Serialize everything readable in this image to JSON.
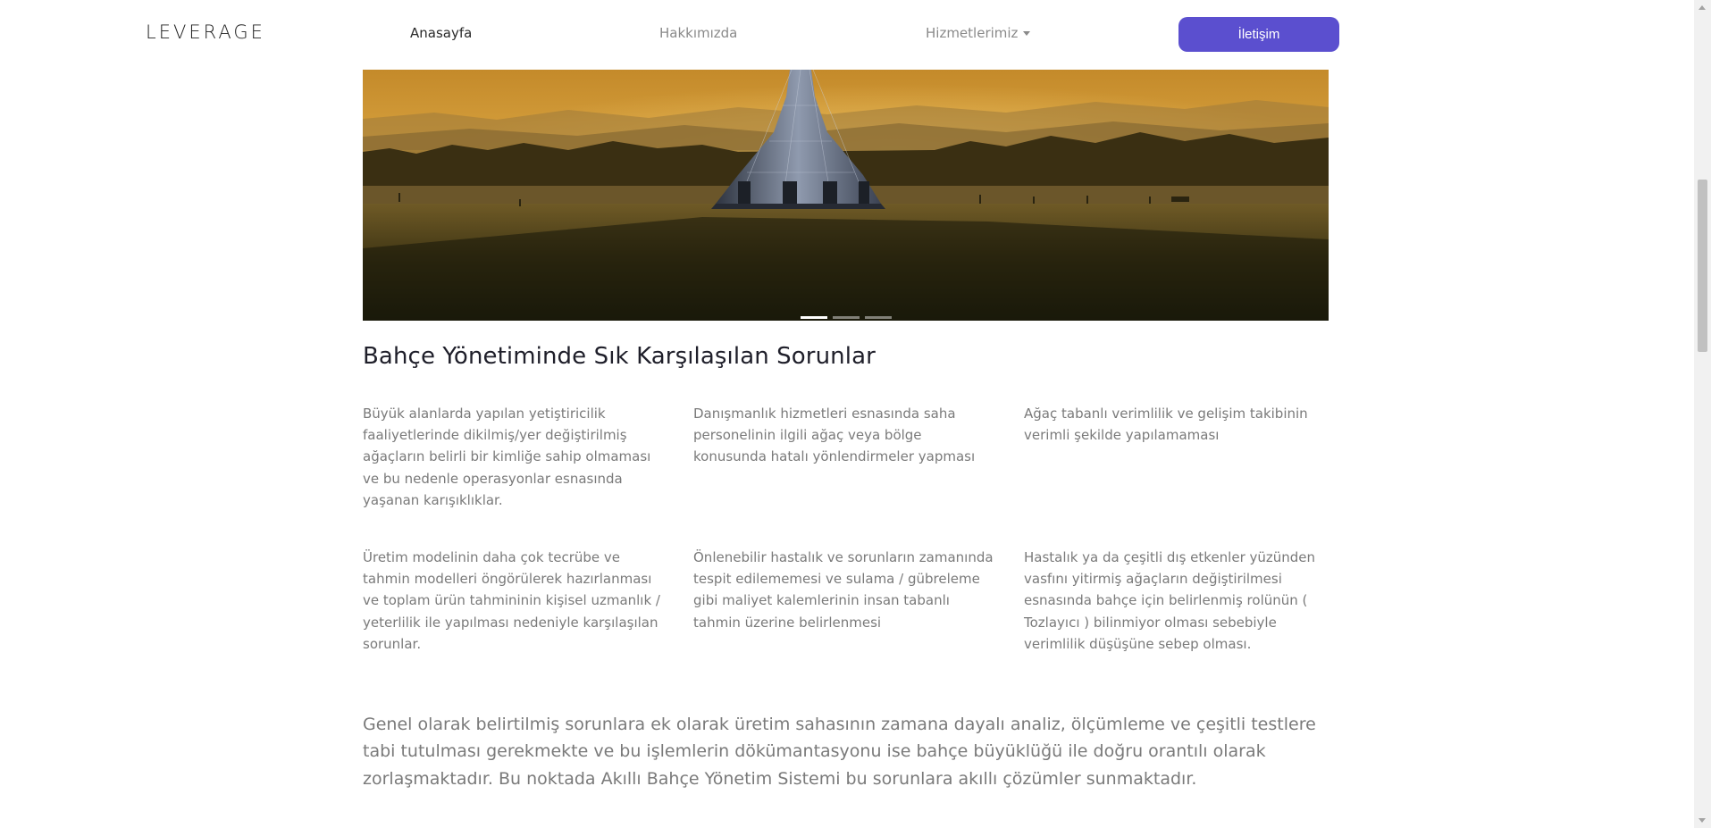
{
  "header": {
    "logo": "LEVERAGE",
    "nav": {
      "home": "Anasayfa",
      "about": "Hakkımızda",
      "services": "Hizmetlerimiz",
      "contact": "İletişim"
    }
  },
  "hero": {
    "slide_count": 3,
    "active_slide": 1
  },
  "section": {
    "title": "Bahçe Yönetiminde Sık Karşılaşılan Sorunlar",
    "problems": [
      "Büyük alanlarda yapılan yetiştiricilik faaliyetlerinde dikilmiş/yer değiştirilmiş ağaçların belirli bir kimliğe sahip olmaması ve bu nedenle operasyonlar esnasında yaşanan karışıklıklar.",
      "Danışmanlık hizmetleri esnasında saha personelinin ilgili ağaç veya bölge konusunda hatalı yönlendirmeler yapması",
      "Ağaç tabanlı verimlilik ve gelişim takibinin verimli şekilde yapılamaması",
      "Üretim modelinin daha çok tecrübe ve tahmin modelleri öngörülerek hazırlanması ve toplam ürün tahmininin kişisel uzmanlık / yeterlilik ile yapılması nedeniyle karşılaşılan sorunlar.",
      "Önlenebilir hastalık ve sorunların zamanında tespit edilememesi ve sulama / gübreleme gibi maliyet kalemlerinin insan tabanlı tahmin üzerine belirlenmesi",
      "Hastalık ya da çeşitli dış etkenler yüzünden vasfını yitirmiş ağaçların değiştirilmesi esnasında bahçe için belirlenmiş rolünün ( Tozlayıcı ) bilinmiyor olması sebebiyle verimlilik düşüşüne sebep olması."
    ],
    "summary": "Genel olarak belirtilmiş sorunlara ek olarak üretim sahasının zamana dayalı analiz, ölçümleme ve çeşitli testlere tabi tutulması gerekmekte ve bu işlemlerin dökümantasyonu ise bahçe büyüklüğü ile doğru orantılı olarak zorlaşmaktadır. Bu noktada Akıllı Bahçe Yönetim Sistemi bu sorunlara akıllı çözümler sunmaktadır."
  },
  "colors": {
    "accent": "#5b4fcf",
    "body_text": "#7a7a7a",
    "heading": "#1f1f2a"
  }
}
